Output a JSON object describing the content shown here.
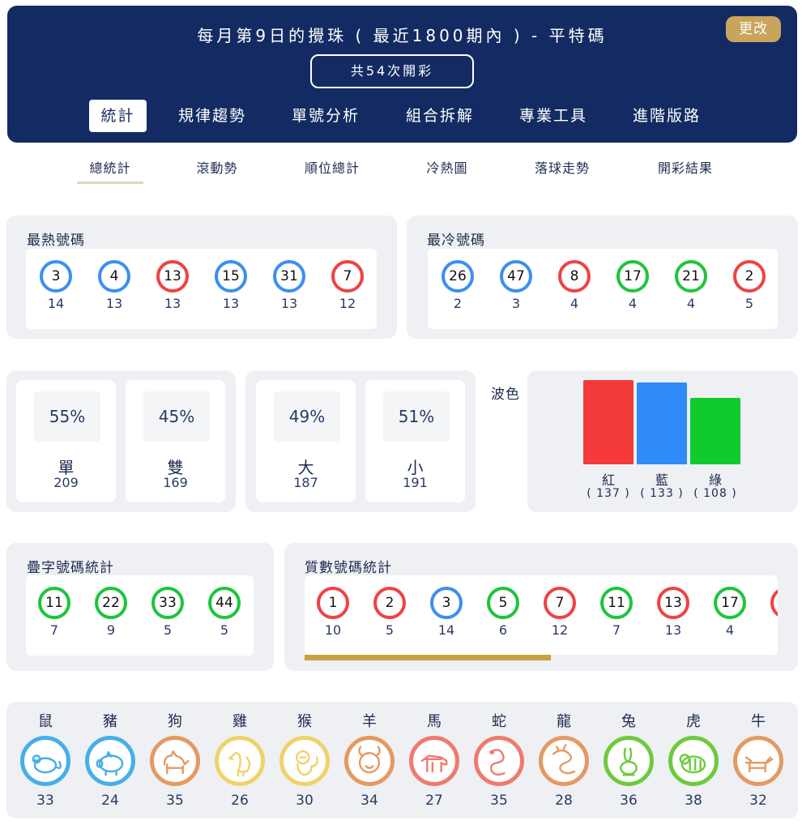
{
  "header": {
    "title": "每月第9日的攪珠 ( 最近1800期內 ) - 平特碼",
    "change_label": "更改",
    "draw_count": "共54次開彩",
    "tabs": [
      "統計",
      "規律趨勢",
      "單號分析",
      "組合拆解",
      "專業工具",
      "進階版路"
    ]
  },
  "sub_tabs": [
    "總統計",
    "滾動勢",
    "順位總計",
    "冷熱圖",
    "落球走勢",
    "開彩結果"
  ],
  "hot": {
    "title": "最熱號碼",
    "balls": [
      {
        "num": "3",
        "count": "14",
        "color": "blue"
      },
      {
        "num": "4",
        "count": "13",
        "color": "blue"
      },
      {
        "num": "13",
        "count": "13",
        "color": "red"
      },
      {
        "num": "15",
        "count": "13",
        "color": "blue"
      },
      {
        "num": "31",
        "count": "13",
        "color": "blue"
      },
      {
        "num": "7",
        "count": "12",
        "color": "red"
      }
    ]
  },
  "cold": {
    "title": "最冷號碼",
    "balls": [
      {
        "num": "26",
        "count": "2",
        "color": "blue"
      },
      {
        "num": "47",
        "count": "3",
        "color": "blue"
      },
      {
        "num": "8",
        "count": "4",
        "color": "red"
      },
      {
        "num": "17",
        "count": "4",
        "color": "green"
      },
      {
        "num": "21",
        "count": "4",
        "color": "green"
      },
      {
        "num": "2",
        "count": "5",
        "color": "red"
      }
    ]
  },
  "odd_even": [
    {
      "pct": "55%",
      "label": "單",
      "count": "209"
    },
    {
      "pct": "45%",
      "label": "雙",
      "count": "169"
    }
  ],
  "big_small": [
    {
      "pct": "49%",
      "label": "大",
      "count": "187"
    },
    {
      "pct": "51%",
      "label": "小",
      "count": "191"
    }
  ],
  "wave": {
    "title": "波色",
    "bars": [
      {
        "label": "紅",
        "count_text": "( 137 )",
        "value": 137,
        "color": "#f53a3a"
      },
      {
        "label": "藍",
        "count_text": "( 133 )",
        "value": 133,
        "color": "#2e8bf7"
      },
      {
        "label": "綠",
        "count_text": "( 108 )",
        "value": 108,
        "color": "#0fcb2b"
      }
    ]
  },
  "double": {
    "title": "疊字號碼統計",
    "balls": [
      {
        "num": "11",
        "count": "7",
        "color": "green"
      },
      {
        "num": "22",
        "count": "9",
        "color": "green"
      },
      {
        "num": "33",
        "count": "5",
        "color": "green"
      },
      {
        "num": "44",
        "count": "5",
        "color": "green"
      }
    ]
  },
  "prime": {
    "title": "質數號碼統計",
    "balls": [
      {
        "num": "1",
        "count": "10",
        "color": "red"
      },
      {
        "num": "2",
        "count": "5",
        "color": "red"
      },
      {
        "num": "3",
        "count": "14",
        "color": "blue"
      },
      {
        "num": "5",
        "count": "6",
        "color": "green"
      },
      {
        "num": "7",
        "count": "12",
        "color": "red"
      },
      {
        "num": "11",
        "count": "7",
        "color": "green"
      },
      {
        "num": "13",
        "count": "13",
        "color": "red"
      },
      {
        "num": "17",
        "count": "4",
        "color": "green"
      }
    ],
    "scroll_position": 0.52
  },
  "zodiac": [
    {
      "name": "鼠",
      "count": "33",
      "icon": "rat-icon",
      "color": "#48aee8"
    },
    {
      "name": "豬",
      "count": "24",
      "icon": "pig-icon",
      "color": "#48aee8"
    },
    {
      "name": "狗",
      "count": "35",
      "icon": "dog-icon",
      "color": "#e49a62"
    },
    {
      "name": "雞",
      "count": "26",
      "icon": "rooster-icon",
      "color": "#f0d26a"
    },
    {
      "name": "猴",
      "count": "30",
      "icon": "monkey-icon",
      "color": "#f0d26a"
    },
    {
      "name": "羊",
      "count": "34",
      "icon": "goat-icon",
      "color": "#e49a62"
    },
    {
      "name": "馬",
      "count": "27",
      "icon": "horse-icon",
      "color": "#f07a6e"
    },
    {
      "name": "蛇",
      "count": "35",
      "icon": "snake-icon",
      "color": "#f07a6e"
    },
    {
      "name": "龍",
      "count": "28",
      "icon": "dragon-icon",
      "color": "#e49a62"
    },
    {
      "name": "兔",
      "count": "36",
      "icon": "rabbit-icon",
      "color": "#6ccb3c"
    },
    {
      "name": "虎",
      "count": "38",
      "icon": "tiger-icon",
      "color": "#6ccb3c"
    },
    {
      "name": "牛",
      "count": "32",
      "icon": "ox-icon",
      "color": "#e49a62"
    }
  ]
}
